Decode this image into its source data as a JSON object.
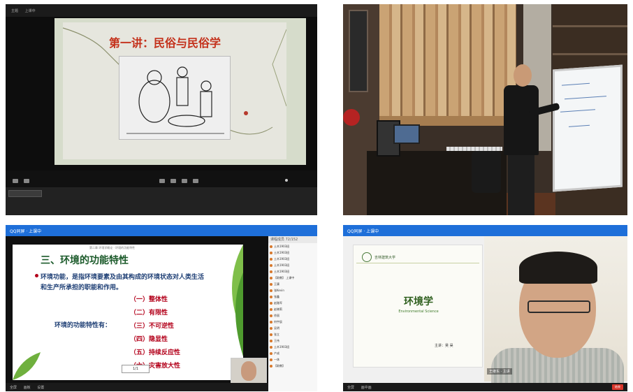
{
  "panel1": {
    "topbar": [
      "主题",
      "上课中"
    ],
    "slide_title": "第一讲：民俗与民俗学"
  },
  "panel3": {
    "app_title": "QQ同屏 · 上课中",
    "slide_header": "第二章 环境学概论 · 环境的功能特性",
    "title": "三、环境的功能特性",
    "definition": "环境功能，是指环境要素及由其构成的环境状态对人类生活和生产所承担的职能和作用。",
    "lead": "环境的功能特性有：",
    "items": [
      "（一）整体性",
      "（二）有限性",
      "（三）不可逆性",
      "（四）隐显性",
      "（五）持续反应性",
      "（六）灾害放大性"
    ],
    "pager": "1/1",
    "sidebar_header": "课程成员 72/152",
    "sidebar_items": [
      "土木1903班",
      "土木1903班",
      "土木1903班",
      "土木1903班",
      "土木1903班",
      "【助教】 上课中",
      "王康",
      "张Kevin",
      "张鑫",
      "赵路军",
      "赵晓莉",
      "徐丽",
      "何宇辰",
      "吴明",
      "张立",
      "王伟",
      "土木1903班",
      "产成",
      "一休",
      "【助教】"
    ],
    "bottombar": [
      "全屏",
      "画板",
      "设置"
    ]
  },
  "panel4": {
    "app_title": "QQ同屏 · 上课中",
    "slide_logo_text": "吉林建筑大学",
    "title": "环境学",
    "subtitle": "Environmental Science",
    "teacher": "主讲：吴 昊",
    "cam_label": "王继东 · 主讲",
    "bottombar": [
      "全屏",
      "画中画"
    ],
    "end_button": "结束"
  }
}
